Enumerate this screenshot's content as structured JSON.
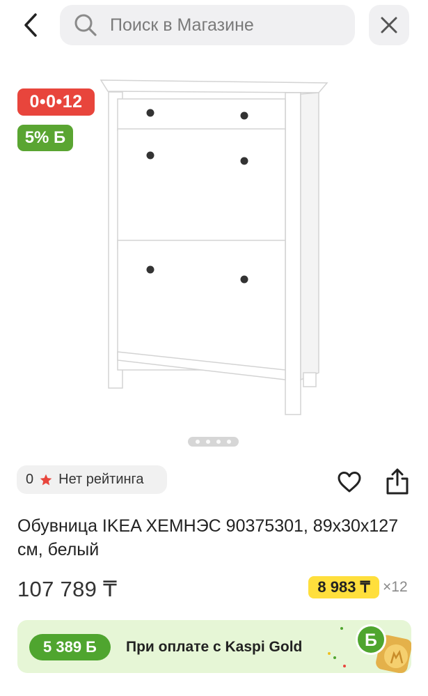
{
  "search": {
    "placeholder": "Поиск в Магазине"
  },
  "badges": {
    "installment": "0•0•12",
    "bonus": "5% Ƃ"
  },
  "rating": {
    "count": "0",
    "text": "Нет рейтинга"
  },
  "product": {
    "title": "Обувница IKEA ХЕМНЭС 90375301, 89х30х127 см, белый"
  },
  "pricing": {
    "price": "107 789 ₸",
    "monthly": "8 983 ₸",
    "months": "×12"
  },
  "gold": {
    "bonus": "5 389 Ƃ",
    "text": "При оплате с Kaspi Gold"
  },
  "icons": [
    "back-icon",
    "search-icon",
    "close-icon",
    "star-icon",
    "heart-icon",
    "share-icon",
    "kaspi-bonus-icon"
  ],
  "colors": {
    "installment_badge": "#e8453c",
    "bonus_green": "#5aa532",
    "monthly_yellow": "#ffdf3c",
    "gold_banner": "#e6f6d6",
    "star": "#e8453c"
  }
}
